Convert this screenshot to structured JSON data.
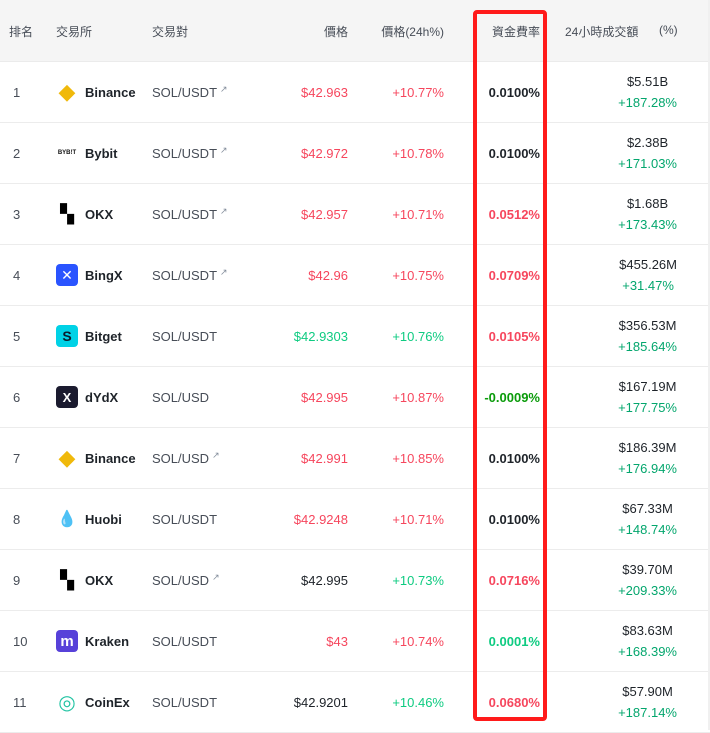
{
  "header": {
    "rank": "排名",
    "exchange": "交易所",
    "pair": "交易對",
    "price": "價格",
    "change": "價格(24h%)",
    "funding": "資金費率",
    "volume": "24小時成交額",
    "volume_unit": "(%)"
  },
  "colors": {
    "up_green": "#0ecb81",
    "down_red": "#f6465d",
    "highlight": "#ff1a1a"
  },
  "rows": [
    {
      "rank": "1",
      "exchange": "Binance",
      "logo_icon": "binance-icon",
      "pair": "SOL/USDT",
      "external": true,
      "price": "$42.963",
      "price_color": "red",
      "change": "+10.77%",
      "change_color": "red",
      "funding": "0.0100%",
      "funding_color": "dark",
      "volume": "$5.51B",
      "volume_change": "+187.28%"
    },
    {
      "rank": "2",
      "exchange": "Bybit",
      "logo_icon": "bybit-icon",
      "pair": "SOL/USDT",
      "external": true,
      "price": "$42.972",
      "price_color": "red",
      "change": "+10.78%",
      "change_color": "red",
      "funding": "0.0100%",
      "funding_color": "dark",
      "volume": "$2.38B",
      "volume_change": "+171.03%"
    },
    {
      "rank": "3",
      "exchange": "OKX",
      "logo_icon": "okx-icon",
      "pair": "SOL/USDT",
      "external": true,
      "price": "$42.957",
      "price_color": "red",
      "change": "+10.71%",
      "change_color": "red",
      "funding": "0.0512%",
      "funding_color": "red",
      "volume": "$1.68B",
      "volume_change": "+173.43%"
    },
    {
      "rank": "4",
      "exchange": "BingX",
      "logo_icon": "bingx-icon",
      "pair": "SOL/USDT",
      "external": true,
      "price": "$42.96",
      "price_color": "red",
      "change": "+10.75%",
      "change_color": "red",
      "funding": "0.0709%",
      "funding_color": "red",
      "volume": "$455.26M",
      "volume_change": "+31.47%"
    },
    {
      "rank": "5",
      "exchange": "Bitget",
      "logo_icon": "bitget-icon",
      "pair": "SOL/USDT",
      "external": false,
      "price": "$42.9303",
      "price_color": "green",
      "change": "+10.76%",
      "change_color": "green",
      "funding": "0.0105%",
      "funding_color": "red",
      "volume": "$356.53M",
      "volume_change": "+185.64%"
    },
    {
      "rank": "6",
      "exchange": "dYdX",
      "logo_icon": "dydx-icon",
      "pair": "SOL/USD",
      "external": false,
      "price": "$42.995",
      "price_color": "red",
      "change": "+10.87%",
      "change_color": "red",
      "funding": "-0.0009%",
      "funding_color": "bright-green",
      "volume": "$167.19M",
      "volume_change": "+177.75%"
    },
    {
      "rank": "7",
      "exchange": "Binance",
      "logo_icon": "binance-icon",
      "pair": "SOL/USD",
      "external": true,
      "price": "$42.991",
      "price_color": "red",
      "change": "+10.85%",
      "change_color": "red",
      "funding": "0.0100%",
      "funding_color": "dark",
      "volume": "$186.39M",
      "volume_change": "+176.94%"
    },
    {
      "rank": "8",
      "exchange": "Huobi",
      "logo_icon": "huobi-icon",
      "pair": "SOL/USDT",
      "external": false,
      "price": "$42.9248",
      "price_color": "red",
      "change": "+10.71%",
      "change_color": "red",
      "funding": "0.0100%",
      "funding_color": "dark",
      "volume": "$67.33M",
      "volume_change": "+148.74%"
    },
    {
      "rank": "9",
      "exchange": "OKX",
      "logo_icon": "okx-icon",
      "pair": "SOL/USD",
      "external": true,
      "price": "$42.995",
      "price_color": "dark",
      "change": "+10.73%",
      "change_color": "green",
      "funding": "0.0716%",
      "funding_color": "red",
      "volume": "$39.70M",
      "volume_change": "+209.33%"
    },
    {
      "rank": "10",
      "exchange": "Kraken",
      "logo_icon": "kraken-icon",
      "pair": "SOL/USDT",
      "external": false,
      "price": "$43",
      "price_color": "red",
      "change": "+10.74%",
      "change_color": "red",
      "funding": "0.0001%",
      "funding_color": "green",
      "volume": "$83.63M",
      "volume_change": "+168.39%"
    },
    {
      "rank": "11",
      "exchange": "CoinEx",
      "logo_icon": "coinex-icon",
      "pair": "SOL/USDT",
      "external": false,
      "price": "$42.9201",
      "price_color": "dark",
      "change": "+10.46%",
      "change_color": "green",
      "funding": "0.0680%",
      "funding_color": "red",
      "volume": "$57.90M",
      "volume_change": "+187.14%"
    }
  ]
}
